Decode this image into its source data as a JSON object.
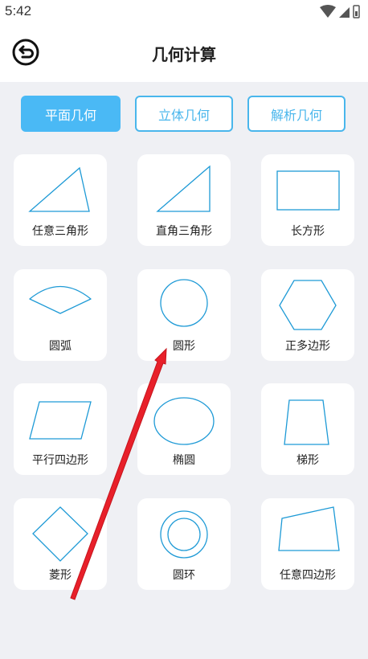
{
  "status_bar": {
    "time": "5:42"
  },
  "header": {
    "title": "几何计算",
    "back_icon": "back-icon"
  },
  "tabs": [
    {
      "label": "平面几何",
      "active": true
    },
    {
      "label": "立体几何",
      "active": false
    },
    {
      "label": "解析几何",
      "active": false
    }
  ],
  "shapes": [
    {
      "label": "任意三角形",
      "icon": "scalene-triangle-icon"
    },
    {
      "label": "直角三角形",
      "icon": "right-triangle-icon"
    },
    {
      "label": "长方形",
      "icon": "rectangle-icon"
    },
    {
      "label": "圆弧",
      "icon": "arc-sector-icon"
    },
    {
      "label": "圆形",
      "icon": "circle-icon"
    },
    {
      "label": "正多边形",
      "icon": "hexagon-icon"
    },
    {
      "label": "平行四边形",
      "icon": "parallelogram-icon"
    },
    {
      "label": "椭圆",
      "icon": "ellipse-icon"
    },
    {
      "label": "梯形",
      "icon": "trapezoid-icon"
    },
    {
      "label": "菱形",
      "icon": "rhombus-icon"
    },
    {
      "label": "圆环",
      "icon": "ring-icon"
    },
    {
      "label": "任意四边形",
      "icon": "quadrilateral-icon"
    }
  ],
  "colors": {
    "accent": "#4ab9f5",
    "shape_stroke": "#1e9ad6",
    "arrow": "#e8202a"
  }
}
